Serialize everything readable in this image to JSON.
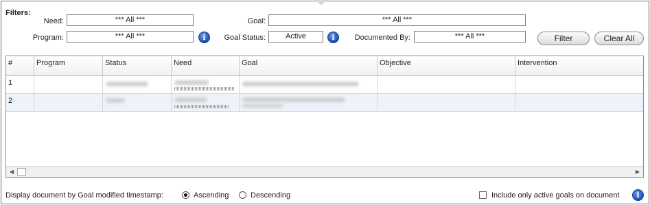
{
  "filters": {
    "heading": "Filters:",
    "need_label": "Need:",
    "need_value": "*** All ***",
    "goal_label": "Goal:",
    "goal_value": "*** All ***",
    "program_label": "Program:",
    "program_value": "*** All ***",
    "goal_status_label": "Goal Status:",
    "goal_status_value": "Active",
    "documented_by_label": "Documented By:",
    "documented_by_value": "*** All ***",
    "info_icon": "i",
    "filter_button": "Filter",
    "clear_all_button": "Clear All"
  },
  "grid": {
    "columns": [
      "#",
      "Program",
      "Status",
      "Need",
      "Goal",
      "Objective",
      "Intervention"
    ],
    "rows": [
      {
        "num": "1"
      },
      {
        "num": "2"
      }
    ],
    "scroll_left_icon": "◀",
    "scroll_right_icon": "▶"
  },
  "footer": {
    "sort_label": "Display document by Goal modified timestamp:",
    "ascending_label": "Ascending",
    "descending_label": "Descending",
    "selected_sort": "Ascending",
    "active_only_label": "Include only active goals on document",
    "active_only_checked": false
  }
}
